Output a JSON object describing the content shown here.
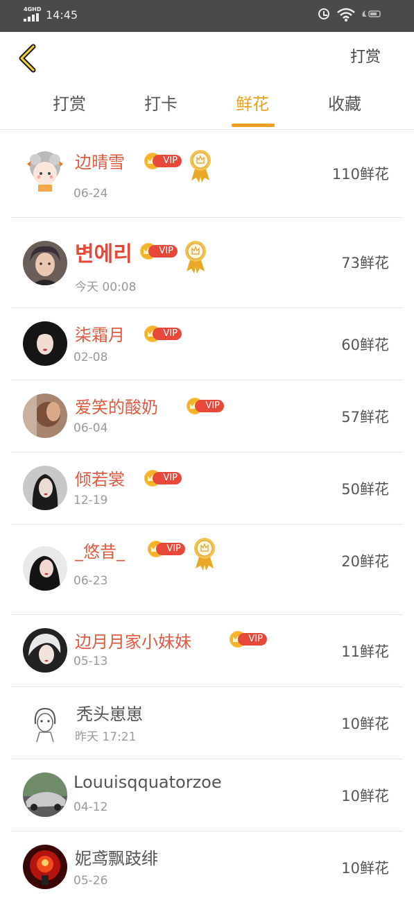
{
  "status_bar": {
    "network": "4GHD",
    "time": "14:45"
  },
  "header": {
    "right_action": "打赏"
  },
  "tabs": [
    {
      "label": "打赏",
      "active": false
    },
    {
      "label": "打卡",
      "active": false
    },
    {
      "label": "鲜花",
      "active": true
    },
    {
      "label": "收藏",
      "active": false
    }
  ],
  "colors": {
    "accent": "#f0a020",
    "vip_red": "#e8483a",
    "name_red": "#e15a3f"
  },
  "list": [
    {
      "name": "边晴雪",
      "vip": true,
      "medal": true,
      "date": "06-24",
      "count": "110鲜花"
    },
    {
      "name": "변에리",
      "vip": true,
      "medal": true,
      "date": "今天 00:08",
      "count": "73鲜花"
    },
    {
      "name": "柒霜月",
      "vip": true,
      "medal": false,
      "date": "02-08",
      "count": "60鲜花"
    },
    {
      "name": "爱笑的酸奶",
      "vip": true,
      "medal": false,
      "date": "06-04",
      "count": "57鲜花"
    },
    {
      "name": "倾若裳",
      "vip": true,
      "medal": false,
      "date": "12-19",
      "count": "50鲜花"
    },
    {
      "name": "_悠昔_",
      "vip": true,
      "medal": true,
      "date": "06-23",
      "count": "20鲜花"
    },
    {
      "name": "边月月家小妹妹",
      "vip": true,
      "medal": false,
      "date": "05-13",
      "count": "11鲜花"
    },
    {
      "name": "秃头崽崽",
      "vip": false,
      "medal": false,
      "date": "昨天 17:21",
      "count": "10鲜花"
    },
    {
      "name": "Louuisqquatorzoe",
      "vip": false,
      "medal": false,
      "date": "04-12",
      "count": "10鲜花"
    },
    {
      "name": "妮鸢飘跂绯",
      "vip": false,
      "medal": false,
      "date": "05-26",
      "count": "10鲜花"
    }
  ],
  "vip_label": "VIP"
}
